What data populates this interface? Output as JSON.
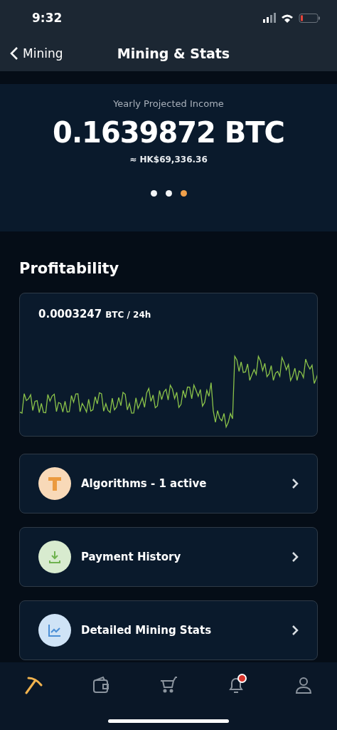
{
  "status_bar": {
    "time": "9:32"
  },
  "nav": {
    "back_label": "Mining",
    "title": "Mining & Stats"
  },
  "hero": {
    "caption": "Yearly Projected Income",
    "amount": "0.1639872 BTC",
    "fiat": "≈ HK$69,336.36",
    "dots": [
      {
        "selected": false
      },
      {
        "selected": false
      },
      {
        "selected": true
      }
    ]
  },
  "profitability": {
    "title": "Profitability",
    "value": "0.0003247",
    "unit": "BTC / 24h"
  },
  "menu": [
    {
      "kind": "algorithms",
      "label": "Algorithms - 1 active"
    },
    {
      "kind": "payments",
      "label": "Payment History"
    },
    {
      "kind": "stats",
      "label": "Detailed Mining Stats"
    }
  ],
  "tab_bar": [
    {
      "kind": "mining",
      "selected": true
    },
    {
      "kind": "wallet",
      "selected": false
    },
    {
      "kind": "shop",
      "selected": false
    },
    {
      "kind": "notifications",
      "selected": false,
      "badge": true
    },
    {
      "kind": "profile",
      "selected": false
    }
  ]
}
